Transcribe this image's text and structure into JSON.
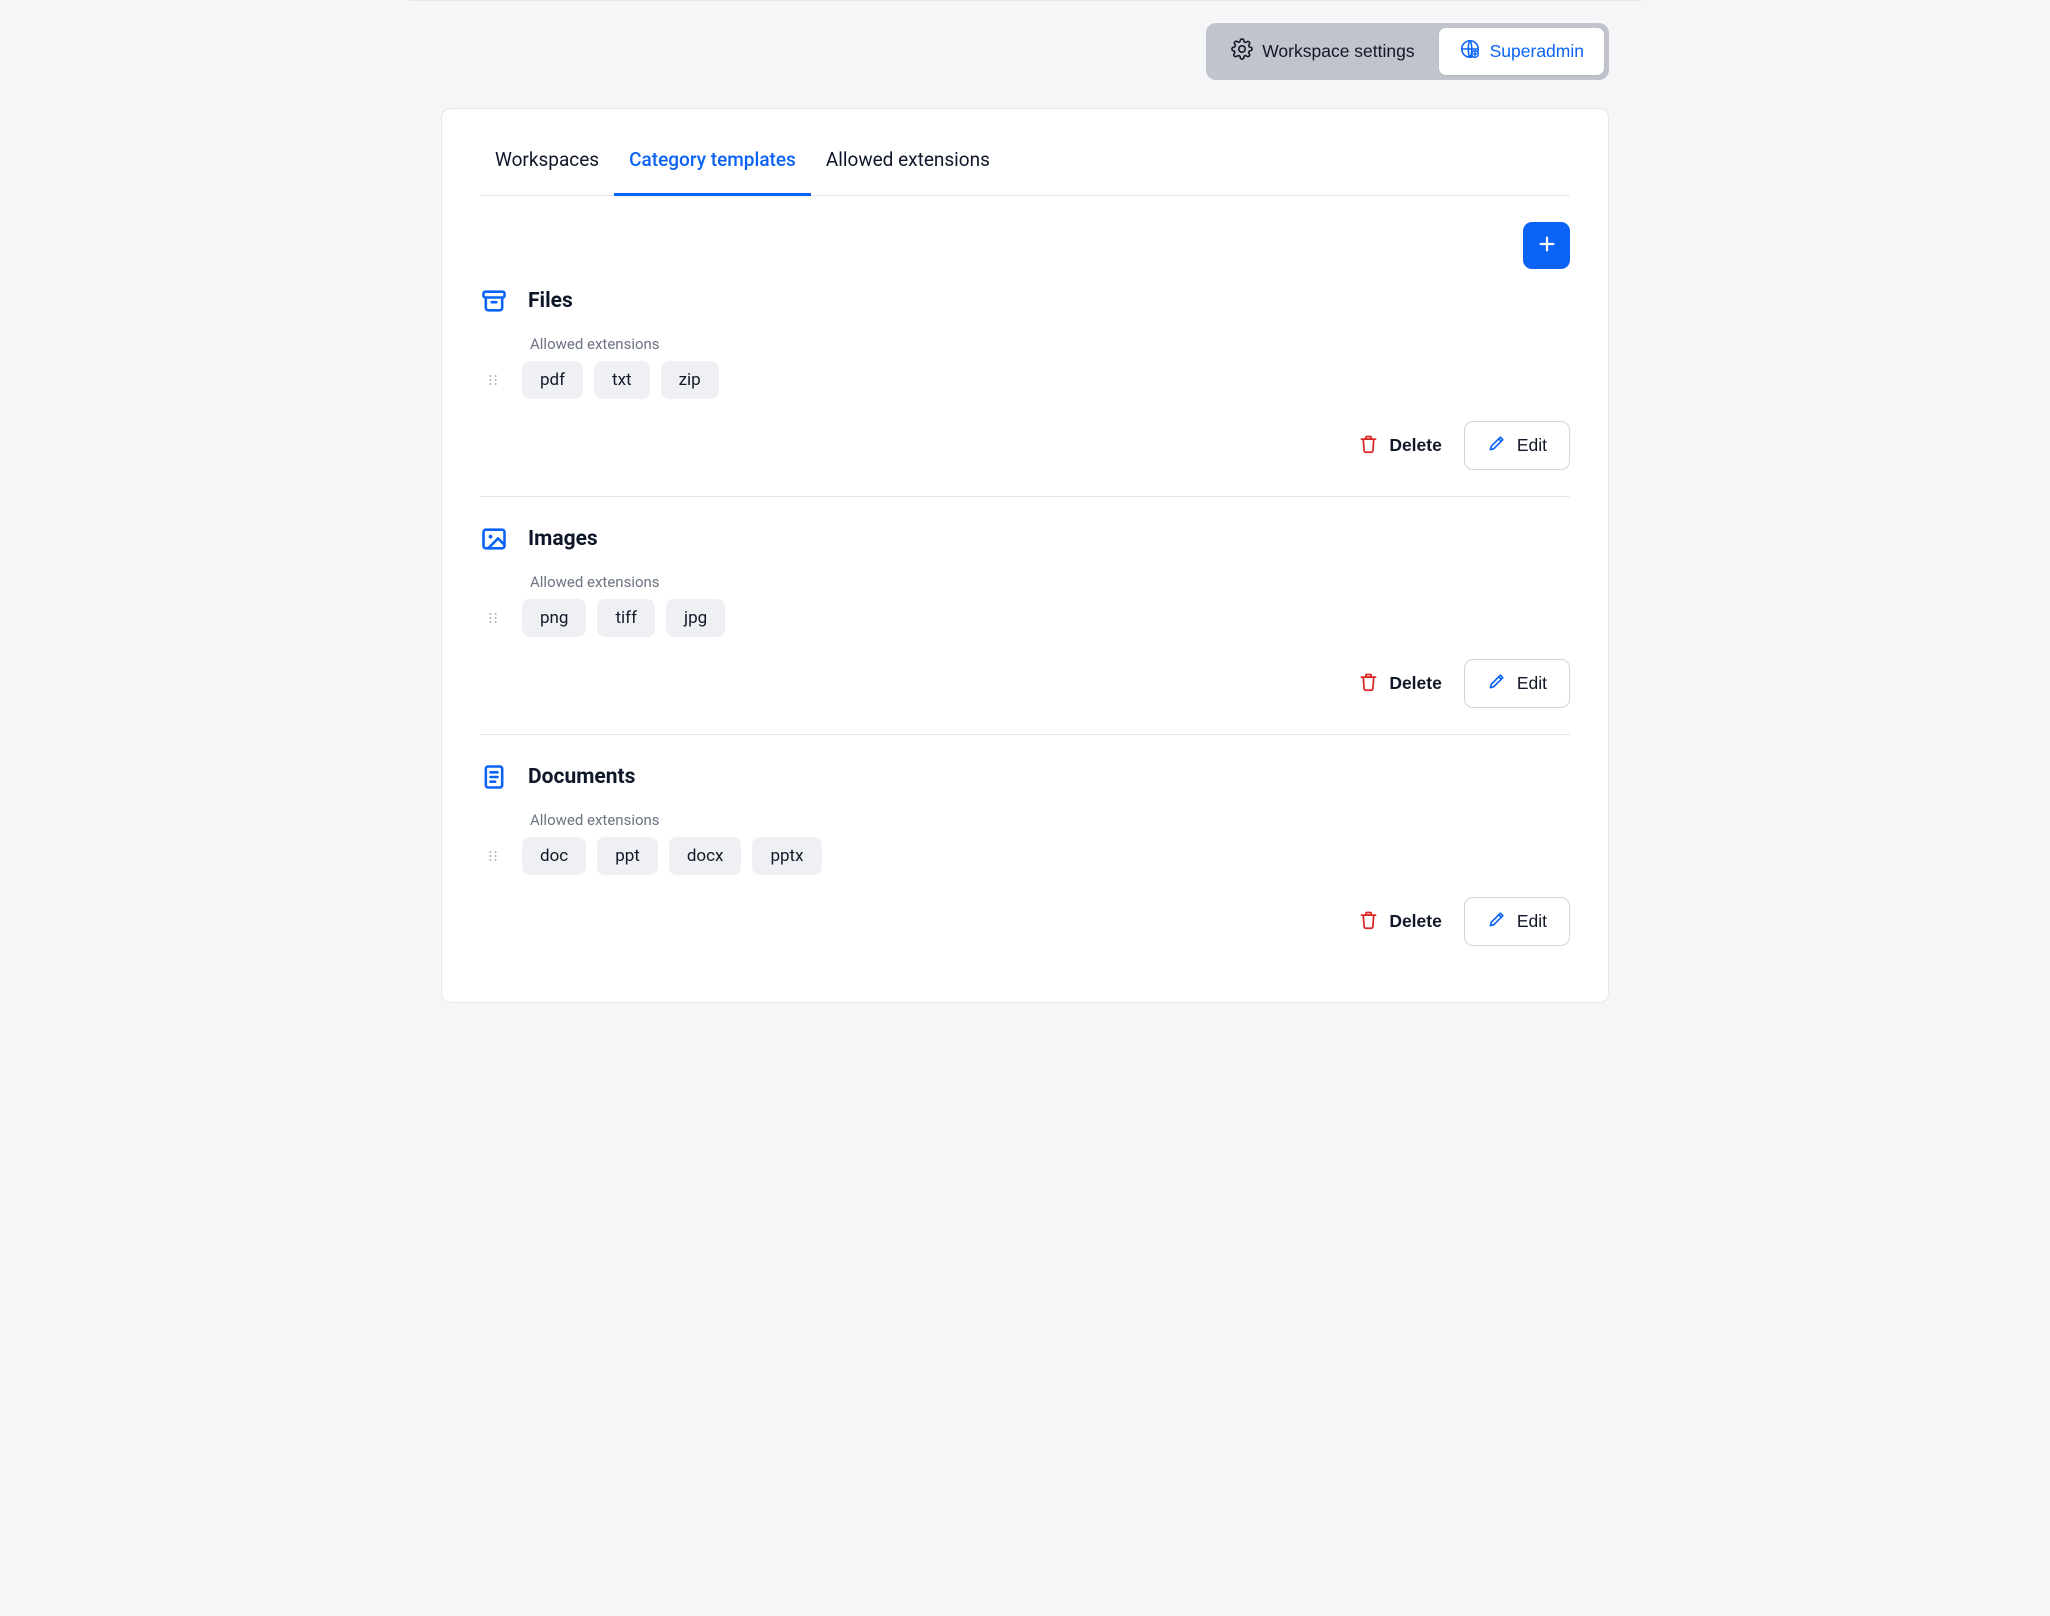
{
  "topbar": {
    "workspace_settings_label": "Workspace settings",
    "superadmin_label": "Superadmin"
  },
  "tabs": {
    "workspaces": "Workspaces",
    "category_templates": "Category templates",
    "allowed_extensions": "Allowed extensions",
    "active": "category_templates"
  },
  "labels": {
    "allowed_extensions": "Allowed extensions",
    "delete": "Delete",
    "edit": "Edit"
  },
  "categories": [
    {
      "icon": "archive",
      "title": "Files",
      "extensions": [
        "pdf",
        "txt",
        "zip"
      ]
    },
    {
      "icon": "image",
      "title": "Images",
      "extensions": [
        "png",
        "tiff",
        "jpg"
      ]
    },
    {
      "icon": "document",
      "title": "Documents",
      "extensions": [
        "doc",
        "ppt",
        "docx",
        "pptx"
      ]
    }
  ]
}
